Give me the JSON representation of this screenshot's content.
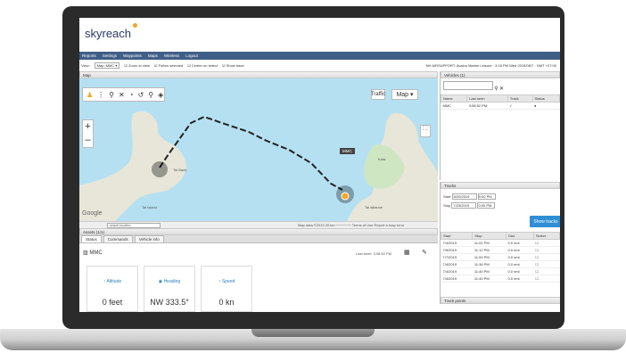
{
  "app": {
    "logo": "skyreach"
  },
  "nav": [
    "Reports",
    "Settings",
    "Waypoints",
    "Maps",
    "Wireless",
    "Logout"
  ],
  "toolbar": {
    "view_label": "View:",
    "view_select": "Map: MMC ▾",
    "options": [
      "Zoom to view",
      "Follow selected",
      "Center on select",
      "Show trace"
    ],
    "right_text": "NH AIRSUPPORT: Avalon Marine Leisure · 3:18 PM Wed 2019/08/7 · GMT +07:00"
  },
  "map": {
    "tab": "Map",
    "traffic_btn": "Traffic",
    "map_btn": "Map",
    "zoom_in": "+",
    "zoom_out": "–",
    "vehicle_label": "MMC",
    "footer_search": "search location",
    "footer_text": "Map data ©2019   20 km ──────   Terms of Use   Report a map error",
    "google": "Google",
    "places": [
      "Kota",
      "Tai Bank",
      "Tai Island",
      "Tai alliance"
    ]
  },
  "vehicles": {
    "title": "Vehicles (1)",
    "columns": [
      "Name",
      "Last seen",
      "Track",
      "Status"
    ],
    "rows": [
      {
        "name": "MMC",
        "last_seen": "3:08:52 PM",
        "track": "✓",
        "status": "●"
      }
    ]
  },
  "tracks": {
    "title": "Tracks",
    "start_label": "Start",
    "start_date": "6/20/2019",
    "start_time": "0:00 PM",
    "end_label": "Stop",
    "end_date": "7/23/2019",
    "end_time": "0:00 PM",
    "show_button": "Show tracks",
    "columns": [
      "Start",
      "Stop",
      "Dist",
      "Select"
    ],
    "rows": [
      {
        "start": "7/4/2019",
        "stop": "11:02 PM",
        "dist": "0.0 nmi"
      },
      {
        "start": "7/5/2019",
        "stop": "11:12 PM",
        "dist": "0.0 nmi"
      },
      {
        "start": "7/7/2019",
        "stop": "11:00 PM",
        "dist": "0.0 nmi"
      },
      {
        "start": "7/4/2019",
        "stop": "11:36 PM",
        "dist": "0.0 nmi"
      },
      {
        "start": "7/4/2019",
        "stop": "11:40 PM",
        "dist": "0.0 nmi"
      },
      {
        "start": "7/4/2019",
        "stop": "11:40 PM",
        "dist": "0.0 nmi"
      }
    ],
    "points_title": "Track points"
  },
  "assets": {
    "title": "Assets (1/1)",
    "tabs": [
      "Status",
      "Commands",
      "Vehicle info"
    ],
    "vehicle": "MMC",
    "last_seen": "Last seen: 3:08:52 PM",
    "cards": [
      {
        "label": "Altitude",
        "value": "0 feet"
      },
      {
        "label": "Heading",
        "value": "NW 333.5°"
      },
      {
        "label": "Speed",
        "value": "0 kn"
      }
    ]
  }
}
